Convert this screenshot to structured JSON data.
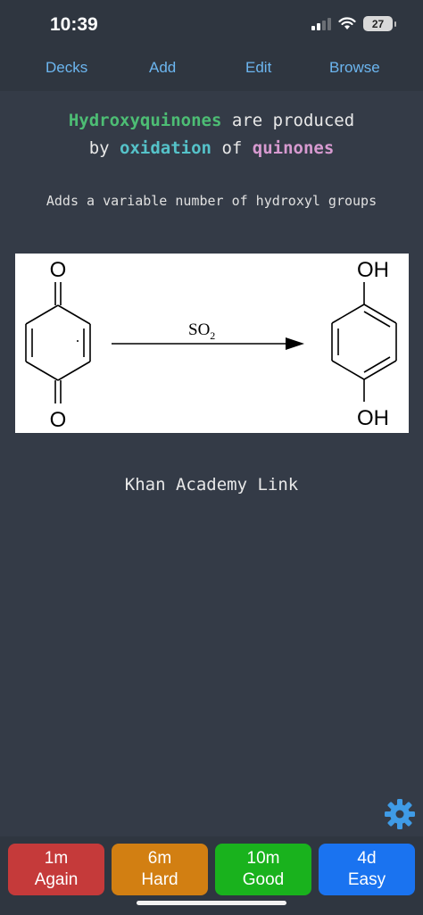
{
  "status": {
    "time": "10:39",
    "battery": "27"
  },
  "nav": {
    "decks": "Decks",
    "add": "Add",
    "edit": "Edit",
    "browse": "Browse"
  },
  "card": {
    "front": {
      "word1": "Hydroxyquinones",
      "text1": " are produced",
      "text2": "by ",
      "word2": "oxidation",
      "text3": " of ",
      "word3": "quinones"
    },
    "subtext": "Adds a variable number of hydroxyl groups",
    "diagram": {
      "reagent": "SO",
      "reagent_sub": "2",
      "left_top": "O",
      "left_bottom": "O",
      "right_top": "OH",
      "right_bottom": "OH"
    },
    "link": "Khan Academy Link"
  },
  "answers": [
    {
      "interval": "1m",
      "label": "Again",
      "color": "#c53a3a"
    },
    {
      "interval": "6m",
      "label": "Hard",
      "color": "#d27f12"
    },
    {
      "interval": "10m",
      "label": "Good",
      "color": "#19b21d"
    },
    {
      "interval": "4d",
      "label": "Easy",
      "color": "#1a73f0"
    }
  ],
  "icons": {
    "gear": "gear-icon",
    "signal": "signal-icon",
    "wifi": "wifi-icon",
    "battery": "battery-icon"
  },
  "colors": {
    "accent": "#6cb6f0",
    "background": "#2f3640",
    "gear": "#3f9be6"
  }
}
